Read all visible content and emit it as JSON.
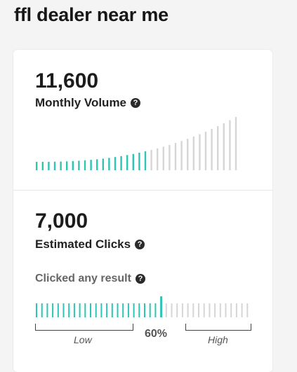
{
  "header": {
    "keyword": "ffl dealer near me"
  },
  "volume": {
    "value": "11,600",
    "label": "Monthly Volume",
    "help_icon": "question-circle-icon",
    "bars_total": 34,
    "bars_filled": 19,
    "colors": {
      "filled": "#2ec5b4",
      "empty": "#d6d6d6"
    }
  },
  "clicks": {
    "value": "7,000",
    "label": "Estimated Clicks",
    "help_icon": "question-circle-icon",
    "clicked_any_result": {
      "label": "Clicked any result",
      "percent_text": "60%",
      "fraction": 0.6,
      "low_label": "Low",
      "high_label": "High",
      "colors": {
        "filled": "#2ec5b4",
        "empty": "#d6d6d6",
        "marker": "#2ec5b4"
      }
    }
  }
}
